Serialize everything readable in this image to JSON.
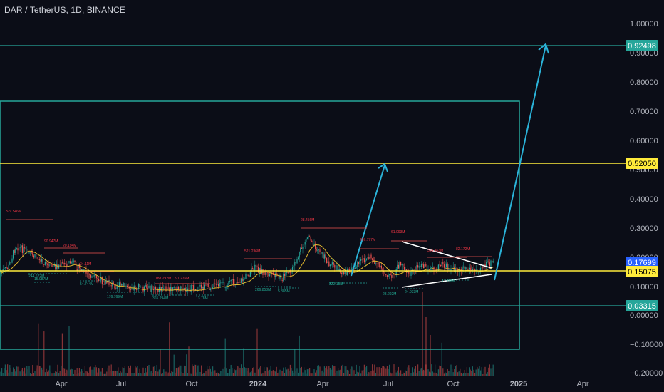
{
  "header": {
    "title": "DAR / TetherUS, 1D, BINANCE"
  },
  "colors": {
    "background": "#0b0d17",
    "teal": "#26a69a",
    "yellow": "#ffeb3b",
    "cyan_arrow": "#2bb3d9",
    "price_line": "#2962ff",
    "candle_up": "#26a69a",
    "candle_down": "#ef5350",
    "ma": "#e0b82e"
  },
  "price_axis": {
    "ticks": [
      "1.00000",
      "0.90000",
      "0.80000",
      "0.70000",
      "0.60000",
      "0.50000",
      "0.40000",
      "0.30000",
      "0.20000",
      "0.10000",
      "0.00000",
      "−0.10000",
      "−0.20000"
    ],
    "badges": [
      {
        "label": "0.92498",
        "kind": "teal"
      },
      {
        "label": "0.52050",
        "kind": "yellow"
      },
      {
        "label": "0.17699",
        "kind": "blue"
      },
      {
        "label": "0.15075",
        "kind": "yellow"
      },
      {
        "label": "0.03315",
        "kind": "teal"
      }
    ]
  },
  "time_axis": {
    "ticks": [
      "Apr",
      "Jul",
      "Oct",
      "2024",
      "Apr",
      "Jul",
      "Oct",
      "2025",
      "Apr"
    ]
  },
  "annotations": [
    {
      "text": "329.546M",
      "kind": "red"
    },
    {
      "text": "90.947M",
      "kind": "red"
    },
    {
      "text": "20.194M",
      "kind": "red"
    },
    {
      "text": "34.11M",
      "kind": "red"
    },
    {
      "text": "188.292M",
      "kind": "red"
    },
    {
      "text": "91.276M",
      "kind": "red"
    },
    {
      "text": "521.236M",
      "kind": "red"
    },
    {
      "text": "28.456M",
      "kind": "red"
    },
    {
      "text": "267.777M",
      "kind": "red"
    },
    {
      "text": "61.093M",
      "kind": "red"
    },
    {
      "text": "364.463M",
      "kind": "red"
    },
    {
      "text": "82.172M",
      "kind": "red"
    },
    {
      "text": "244.622M",
      "kind": "teal"
    },
    {
      "text": "15.987M",
      "kind": "teal"
    },
    {
      "text": "54.744M",
      "kind": "teal"
    },
    {
      "text": "176.769M",
      "kind": "teal"
    },
    {
      "text": "365.294M",
      "kind": "teal"
    },
    {
      "text": "13.78M",
      "kind": "teal"
    },
    {
      "text": "266.858M",
      "kind": "teal"
    },
    {
      "text": "5.385M",
      "kind": "teal"
    },
    {
      "text": "322.13M",
      "kind": "teal"
    },
    {
      "text": "28.292M",
      "kind": "teal"
    },
    {
      "text": "24.933M",
      "kind": "teal"
    },
    {
      "text": "17.186M",
      "kind": "teal"
    }
  ]
}
